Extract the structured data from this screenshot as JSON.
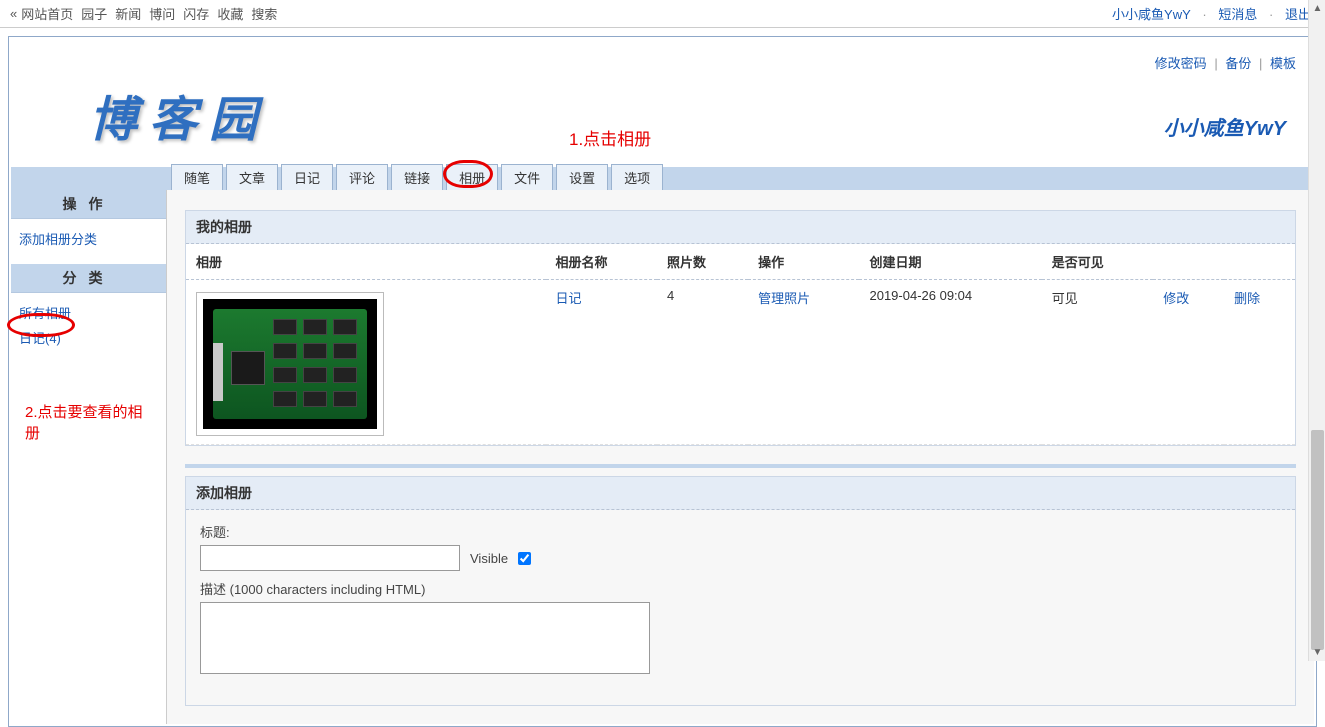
{
  "topbar": {
    "prefix": "«",
    "links": [
      "网站首页",
      "园子",
      "新闻",
      "博问",
      "闪存",
      "收藏",
      "搜索"
    ],
    "right_user": "小小咸鱼YwY",
    "right_msg": "短消息",
    "right_logout": "退出"
  },
  "header": {
    "right_links": [
      "修改密码",
      "备份",
      "模板"
    ],
    "logo": "博 客 园",
    "user": "小小咸鱼YwY"
  },
  "annotations": {
    "a1": "1.点击相册",
    "a2": "2.点击要查看的相册"
  },
  "tabs": [
    "随笔",
    "文章",
    "日记",
    "评论",
    "链接",
    "相册",
    "文件",
    "设置",
    "选项"
  ],
  "sidebar": {
    "ops_title": "操作",
    "ops_add": "添加相册分类",
    "cat_title": "分类",
    "cat_all": "所有相册",
    "cat_diary": "日记(4)"
  },
  "albums_panel": {
    "title": "我的相册",
    "cols": {
      "album": "相册",
      "name": "相册名称",
      "count": "照片数",
      "ops": "操作",
      "date": "创建日期",
      "visible": "是否可见"
    },
    "row": {
      "name": "日记",
      "count": "4",
      "ops": "管理照片",
      "date": "2019-04-26 09:04",
      "visible": "可见",
      "edit": "修改",
      "delete": "删除"
    }
  },
  "add_panel": {
    "title": "添加相册",
    "title_label": "标题:",
    "visible_label": "Visible",
    "desc_label": "描述 (1000 characters including HTML)"
  }
}
